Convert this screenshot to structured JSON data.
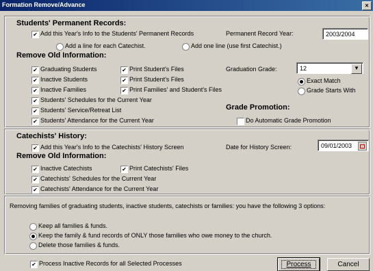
{
  "window": {
    "title": "Formation Remove/Advance",
    "close_label": "×"
  },
  "students": {
    "heading": "Students' Permanent Records:",
    "add_info": {
      "label": "Add this Year's Info to the Students' Permanent Records",
      "checked": true
    },
    "perm_year_label": "Permanent Record Year:",
    "perm_year_value": "2003/2004",
    "line_each": {
      "label": "Add a line for each Catechist.",
      "selected": false
    },
    "line_one": {
      "label": "Add one line (use first Catechist.)",
      "selected": false
    },
    "remove_heading": "Remove Old Information:",
    "graduating": {
      "label": "Graduating Students",
      "checked": true
    },
    "inactive_students": {
      "label": "Inactive Students",
      "checked": true
    },
    "inactive_families": {
      "label": "Inactive Families",
      "checked": true
    },
    "print_files_1": {
      "label": "Print Student's Files",
      "checked": true
    },
    "print_files_2": {
      "label": "Print Student's Files",
      "checked": true
    },
    "print_families": {
      "label": "Print Families' and Student's Files",
      "checked": true
    },
    "schedules": {
      "label": "Students' Schedules for the Current Year",
      "checked": true
    },
    "service": {
      "label": "Students' Service/Retreat List",
      "checked": true
    },
    "attendance": {
      "label": "Students' Attendance for the Current Year",
      "checked": true
    },
    "grad_grade_label": "Graduation Grade:",
    "grad_grade_value": "12",
    "exact_match": {
      "label": "Exact Match",
      "selected": true
    },
    "starts_with": {
      "label": "Grade Starts With",
      "selected": false
    },
    "promotion_heading": "Grade Promotion:",
    "auto_promotion": {
      "label": "Do Automatic Grade Promotion",
      "checked": false
    }
  },
  "catechists": {
    "heading": "Catechists' History:",
    "add_info": {
      "label": "Add this Year's Info to the Catechists' History Screen",
      "checked": true
    },
    "date_label": "Date for History Screen:",
    "date_value": "09/01/2003",
    "remove_heading": "Remove Old Information:",
    "inactive": {
      "label": "Inactive Catechists",
      "checked": true
    },
    "print_files": {
      "label": "Print Catechists' Files",
      "checked": true
    },
    "schedules": {
      "label": "Catechists' Schedules for the Current Year",
      "checked": true
    },
    "attendance": {
      "label": "Catechists' Attendance for the Current Year",
      "checked": true
    }
  },
  "families": {
    "info": "Removing families of graduating students, inactive students, catechists or families:   you have the following 3 options:",
    "keep_all": {
      "label": "Keep all families & funds.",
      "selected": false
    },
    "keep_owe": {
      "label": "Keep the family & fund records of ONLY those families who owe money to the church.",
      "selected": true
    },
    "delete": {
      "label": "Delete those families & funds.",
      "selected": false
    }
  },
  "footer": {
    "process_inactive": {
      "label": "Process Inactive Records for all Selected Processes",
      "checked": true
    },
    "process_button": "Process",
    "cancel_button": "Cancel"
  }
}
